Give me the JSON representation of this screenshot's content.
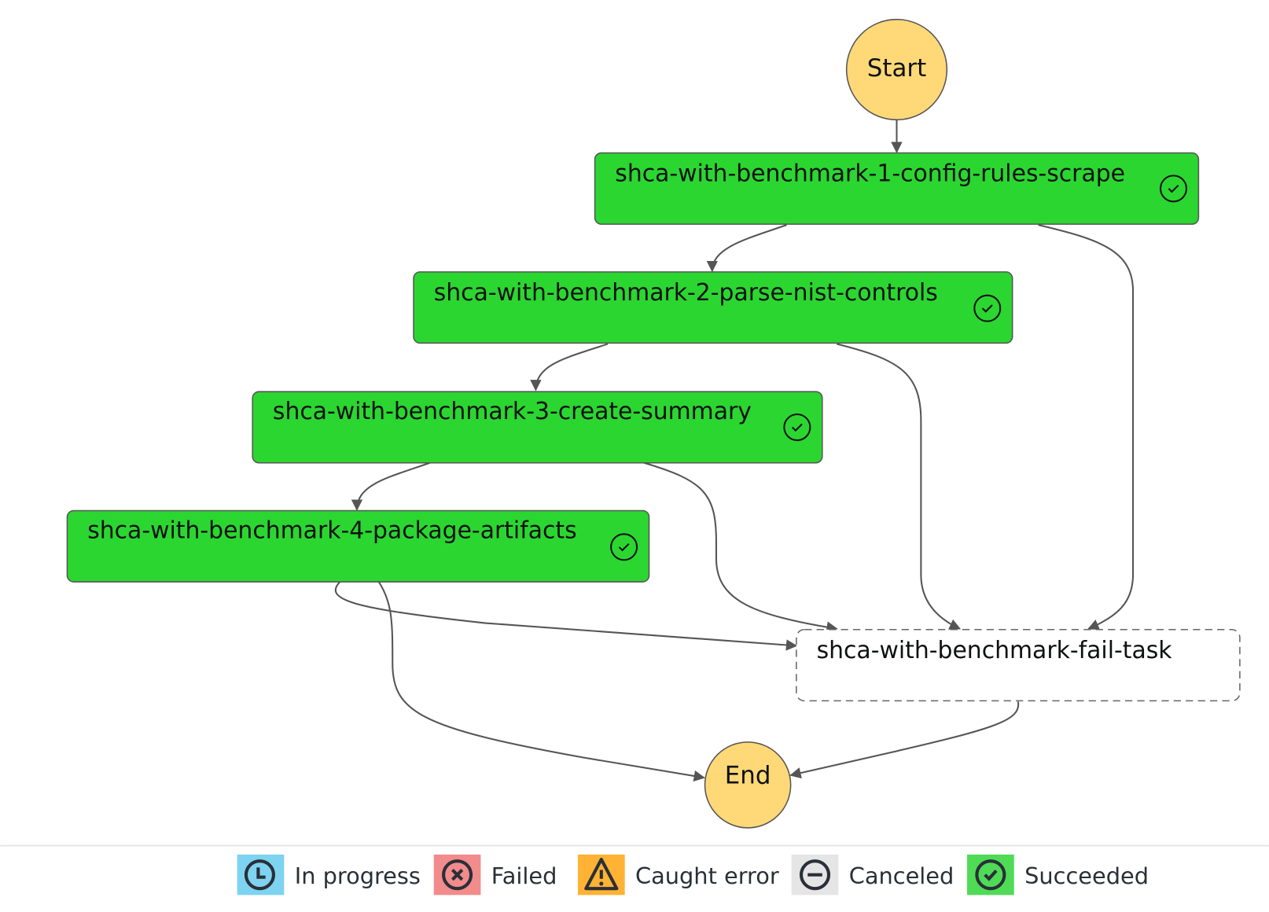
{
  "graph": {
    "nodes": [
      {
        "id": "start",
        "type": "terminal",
        "label": "Start",
        "status": "none"
      },
      {
        "id": "step1",
        "type": "task",
        "label": "shca-with-benchmark-1-config-rules-scrape",
        "status": "succeeded"
      },
      {
        "id": "step2",
        "type": "task",
        "label": "shca-with-benchmark-2-parse-nist-controls",
        "status": "succeeded"
      },
      {
        "id": "step3",
        "type": "task",
        "label": "shca-with-benchmark-3-create-summary",
        "status": "succeeded"
      },
      {
        "id": "step4",
        "type": "task",
        "label": "shca-with-benchmark-4-package-artifacts",
        "status": "succeeded"
      },
      {
        "id": "fail",
        "type": "task-not-run",
        "label": "shca-with-benchmark-fail-task",
        "status": "not-started"
      },
      {
        "id": "end",
        "type": "terminal",
        "label": "End",
        "status": "none"
      }
    ],
    "edges": [
      {
        "from": "start",
        "to": "step1"
      },
      {
        "from": "step1",
        "to": "step2"
      },
      {
        "from": "step1",
        "to": "fail"
      },
      {
        "from": "step2",
        "to": "step3"
      },
      {
        "from": "step2",
        "to": "fail"
      },
      {
        "from": "step3",
        "to": "step4"
      },
      {
        "from": "step3",
        "to": "fail"
      },
      {
        "from": "step4",
        "to": "fail"
      },
      {
        "from": "step4",
        "to": "end"
      },
      {
        "from": "fail",
        "to": "end"
      }
    ]
  },
  "colors": {
    "terminal_fill": "#ffd978",
    "succeeded_fill": "#2bd631",
    "node_border": "#555555",
    "edge": "#555555",
    "in_progress": "#7dd3f0",
    "failed": "#f28b8b",
    "caught_error": "#ffb233",
    "canceled": "#e5e5e5",
    "succeeded": "#4fdb55"
  },
  "legend": [
    {
      "key": "in_progress",
      "label": "In progress",
      "icon": "clock-icon"
    },
    {
      "key": "failed",
      "label": "Failed",
      "icon": "x-circle-icon"
    },
    {
      "key": "caught_error",
      "label": "Caught error",
      "icon": "warning-icon"
    },
    {
      "key": "canceled",
      "label": "Canceled",
      "icon": "minus-circle-icon"
    },
    {
      "key": "succeeded",
      "label": "Succeeded",
      "icon": "check-circle-icon"
    }
  ]
}
